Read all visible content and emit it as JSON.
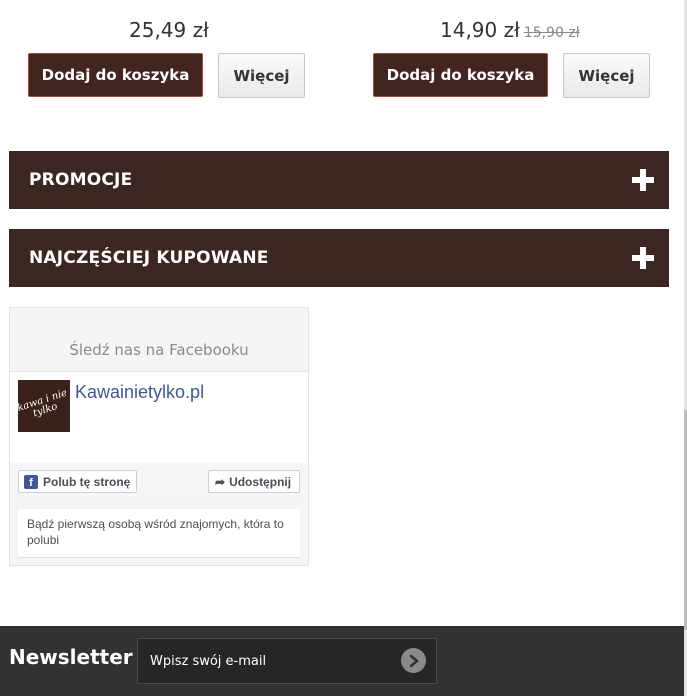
{
  "products": [
    {
      "price": "25,49 zł",
      "old_price": "",
      "cart_label": "Dodaj do koszyka",
      "more_label": "Więcej"
    },
    {
      "price": "14,90 zł",
      "old_price": "15,90 zł",
      "cart_label": "Dodaj do koszyka",
      "more_label": "Więcej"
    }
  ],
  "accordions": [
    {
      "title": "PROMOCJE",
      "icon": "plus-icon"
    },
    {
      "title": "NAJCZĘŚCIEJ KUPOWANE",
      "icon": "plus-icon"
    }
  ],
  "facebook": {
    "heading": "Śledź nas na Facebooku",
    "page_name": "Kawainietylko.pl",
    "logo_text": "kawa i nie tylko",
    "like_label": "Polub tę stronę",
    "share_label": "Udostępnij",
    "friends_text": "Bądź pierwszą osobą wśród znajomych, która to polubi"
  },
  "newsletter": {
    "title": "Newsletter",
    "placeholder": "Wpisz swój e-mail",
    "submit_icon": "arrow-right-icon"
  },
  "colors": {
    "accent_dark": "#3b2622",
    "cart_button": "#432520",
    "cart_border": "#b8452f",
    "facebook_blue": "#3b5998",
    "footer_bg": "#323232"
  }
}
